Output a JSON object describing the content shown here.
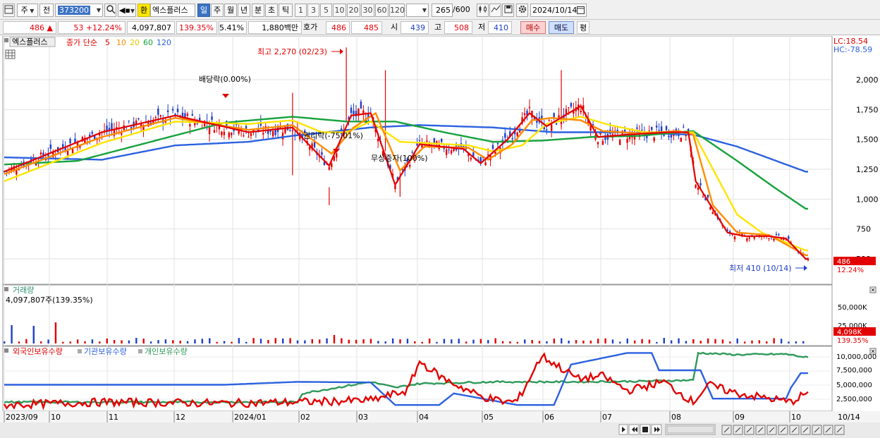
{
  "toolbar": {
    "market_label": "주",
    "prev_label": "전",
    "code": "373200",
    "exchange_tag": "환",
    "stock_name": "엑스플러스",
    "periods": [
      "일",
      "주",
      "월",
      "년",
      "분",
      "초",
      "틱"
    ],
    "active_period": "일",
    "intervals": [
      "1",
      "3",
      "5",
      "10",
      "20",
      "30",
      "60",
      "120"
    ],
    "count_value": "265",
    "count_total": "/600",
    "date": "2024/10/14"
  },
  "quote": {
    "price": "486",
    "change_arrow": "▲",
    "change": "53",
    "change_pct": "+12.24%",
    "volume": "4,097,807",
    "volume_ratio": "139.35%",
    "turnover_pct": "5.41%",
    "amount": "1,880백만",
    "hoga_label": "호가",
    "ask": "486",
    "bid": "485",
    "open_label": "시",
    "open": "439",
    "high_label": "고",
    "high": "508",
    "low_label": "저",
    "low": "410",
    "buy_label": "매수",
    "sell_label": "매도",
    "eval_label": "평"
  },
  "price_pane": {
    "stock_title": "엑스플러스",
    "ma_label": "종가 단순",
    "ma_periods": [
      "5",
      "10",
      "20",
      "60",
      "120"
    ],
    "ma_colors": [
      "#e30000",
      "#ff8c00",
      "#ffe400",
      "#16a23c",
      "#2b61e0"
    ],
    "lc": "LC:18.54",
    "hc": "HC:-78.59",
    "y_ticks": [
      "2,000",
      "1,750",
      "1,500",
      "1,250",
      "1,000",
      "750",
      "500"
    ],
    "current_price_tag": "486",
    "current_pct_tag": "12.24%",
    "annot_high": "최고 2,270 (02/23)",
    "annot_low": "최저 410 (10/14)",
    "annot_div1": "배당락(0.00%)",
    "annot_div2": "권리락(-75.01%)",
    "annot_bonus": "무상증자(100%)"
  },
  "volume_pane": {
    "title": "거래량",
    "value": "4,097,807주(139.35%)",
    "y_ticks": [
      "50,000K",
      "25,000K"
    ],
    "vol_tag": "4,098K",
    "vol_pct_tag": "139.35%"
  },
  "holding_pane": {
    "legend": [
      "외국인보유수량",
      "기관보유수량",
      "개인보유수량"
    ],
    "legend_colors": [
      "#e30000",
      "#2b61e0",
      "#2e9a5a"
    ],
    "y_ticks": [
      "10,000,000",
      "7,500,000",
      "5,000,000",
      "2,500,000"
    ]
  },
  "x_axis": {
    "labels": [
      "2023/09",
      "10",
      "11",
      "12",
      "2024/01",
      "02",
      "03",
      "04",
      "05",
      "06",
      "07",
      "08",
      "09",
      "10"
    ],
    "end_label": "10/14"
  },
  "chart_data": {
    "type": "candlestick",
    "ma_close_series": [
      {
        "name": "5",
        "values_keypoints": [
          [
            0,
            1230
          ],
          [
            40,
            1560
          ],
          [
            70,
            1700
          ],
          [
            100,
            1560
          ],
          [
            118,
            1600
          ],
          [
            124,
            1470
          ],
          [
            133,
            1280
          ],
          [
            142,
            1700
          ],
          [
            150,
            1720
          ],
          [
            160,
            1120
          ],
          [
            170,
            1460
          ],
          [
            188,
            1420
          ],
          [
            195,
            1300
          ],
          [
            206,
            1500
          ],
          [
            215,
            1720
          ],
          [
            222,
            1610
          ],
          [
            236,
            1780
          ],
          [
            243,
            1520
          ],
          [
            255,
            1540
          ],
          [
            272,
            1560
          ],
          [
            280,
            1560
          ],
          [
            283,
            1150
          ],
          [
            296,
            720
          ],
          [
            303,
            690
          ],
          [
            313,
            690
          ],
          [
            320,
            670
          ],
          [
            328,
            500
          ]
        ]
      },
      {
        "name": "10",
        "values_keypoints": [
          [
            0,
            1210
          ],
          [
            40,
            1520
          ],
          [
            70,
            1680
          ],
          [
            100,
            1580
          ],
          [
            118,
            1620
          ],
          [
            126,
            1500
          ],
          [
            134,
            1380
          ],
          [
            143,
            1600
          ],
          [
            152,
            1720
          ],
          [
            162,
            1240
          ],
          [
            172,
            1440
          ],
          [
            190,
            1430
          ],
          [
            198,
            1330
          ],
          [
            208,
            1460
          ],
          [
            216,
            1660
          ],
          [
            224,
            1680
          ],
          [
            236,
            1660
          ],
          [
            245,
            1570
          ],
          [
            260,
            1550
          ],
          [
            276,
            1570
          ],
          [
            282,
            1540
          ],
          [
            290,
            950
          ],
          [
            300,
            720
          ],
          [
            313,
            700
          ],
          [
            328,
            530
          ]
        ]
      },
      {
        "name": "20",
        "values_keypoints": [
          [
            0,
            1150
          ],
          [
            40,
            1470
          ],
          [
            70,
            1650
          ],
          [
            100,
            1630
          ],
          [
            118,
            1660
          ],
          [
            130,
            1560
          ],
          [
            140,
            1560
          ],
          [
            150,
            1650
          ],
          [
            162,
            1480
          ],
          [
            172,
            1470
          ],
          [
            190,
            1450
          ],
          [
            200,
            1400
          ],
          [
            212,
            1450
          ],
          [
            222,
            1630
          ],
          [
            236,
            1690
          ],
          [
            248,
            1620
          ],
          [
            262,
            1560
          ],
          [
            282,
            1560
          ],
          [
            300,
            870
          ],
          [
            310,
            720
          ],
          [
            328,
            570
          ]
        ]
      },
      {
        "name": "60",
        "values_keypoints": [
          [
            0,
            1290
          ],
          [
            30,
            1320
          ],
          [
            60,
            1480
          ],
          [
            90,
            1640
          ],
          [
            118,
            1690
          ],
          [
            140,
            1650
          ],
          [
            160,
            1650
          ],
          [
            180,
            1560
          ],
          [
            200,
            1480
          ],
          [
            220,
            1490
          ],
          [
            240,
            1520
          ],
          [
            260,
            1530
          ],
          [
            282,
            1570
          ],
          [
            300,
            1320
          ],
          [
            315,
            1100
          ],
          [
            328,
            920
          ]
        ]
      },
      {
        "name": "120",
        "values_keypoints": [
          [
            0,
            1350
          ],
          [
            40,
            1330
          ],
          [
            70,
            1450
          ],
          [
            100,
            1480
          ],
          [
            118,
            1530
          ],
          [
            150,
            1600
          ],
          [
            170,
            1620
          ],
          [
            200,
            1600
          ],
          [
            225,
            1560
          ],
          [
            250,
            1560
          ],
          [
            282,
            1540
          ],
          [
            300,
            1440
          ],
          [
            328,
            1230
          ]
        ]
      }
    ],
    "highest": 2270,
    "lowest": 410,
    "y_range": [
      500,
      2200
    ]
  }
}
